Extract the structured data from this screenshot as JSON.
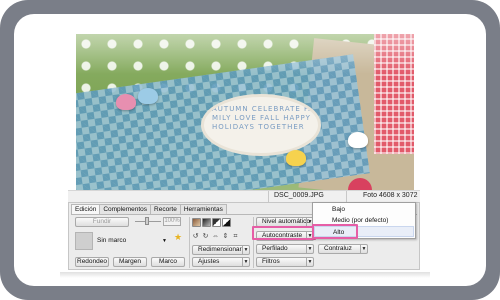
{
  "statusbar": {
    "filename": "DSC_0009.JPG",
    "dimensions": "Foto 4608 x 3072"
  },
  "tabs": [
    {
      "label": "Edición",
      "active": true
    },
    {
      "label": "Complementos",
      "active": false
    },
    {
      "label": "Recorte",
      "active": false
    },
    {
      "label": "Herramientas",
      "active": false
    }
  ],
  "edit": {
    "merge_label": "Fundir",
    "merge_percent": "100%",
    "frame_value": "Sin marco",
    "rounded_label": "Redondeo",
    "margin_label": "Margen",
    "frame_label": "Marco"
  },
  "adjust": {
    "redimensionar_label": "Redimensionar",
    "ajustes_label": "Ajustes",
    "nivel_automatico_label": "Nivel automático",
    "autocontraste_label": "Autocontraste",
    "perfilado_label": "Perfilado",
    "filtros_label": "Filtros",
    "contraluz_label": "Contraluz"
  },
  "dropdown": {
    "items": [
      {
        "label": "Bajo",
        "highlighted": false
      },
      {
        "label": "Medio (por defecto)",
        "highlighted": false
      },
      {
        "label": "Alto",
        "highlighted": true
      }
    ]
  },
  "photo": {
    "sticker_text": "AUTUMN CELEBRATE FAMILY LOVE FALL HAPPY HOLIDAYS TOGETHER"
  },
  "colors": {
    "frame_border": "#7a7e88",
    "highlight": "#e65ea6"
  }
}
